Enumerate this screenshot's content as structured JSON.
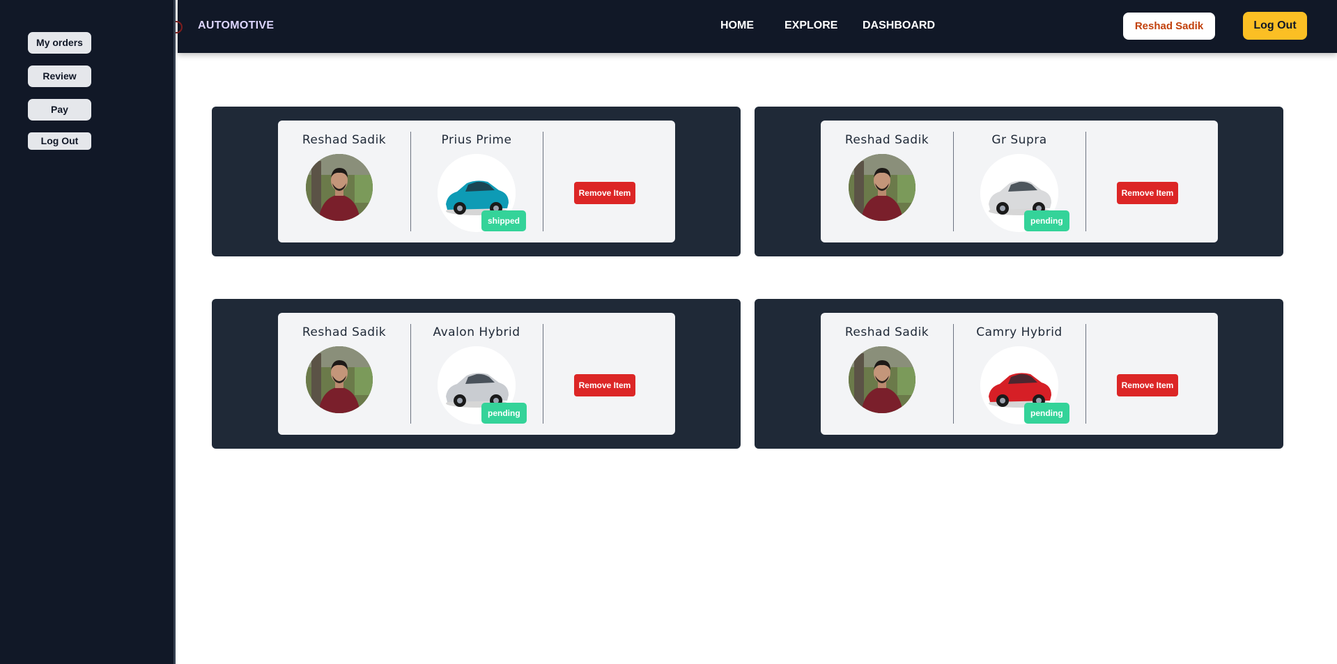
{
  "sidebar": {
    "items": [
      {
        "label": "My orders"
      },
      {
        "label": "Review"
      },
      {
        "label": "Pay"
      },
      {
        "label": "Log Out"
      }
    ]
  },
  "header": {
    "brand": "AUTOMOTIVE",
    "nav": [
      {
        "label": "HOME"
      },
      {
        "label": "EXPLORE"
      },
      {
        "label": "DASHBOARD"
      }
    ],
    "user_name": "Reshad Sadik",
    "logout_label": "Log Out"
  },
  "orders": [
    {
      "user": "Reshad Sadik",
      "product": "Prius Prime",
      "status": "shipped",
      "remove_label": "Remove Item",
      "car_color": "#0e9bb5"
    },
    {
      "user": "Reshad Sadik",
      "product": "Gr Supra",
      "status": "pending",
      "remove_label": "Remove Item",
      "car_color": "#d9dadc"
    },
    {
      "user": "Reshad Sadik",
      "product": "Avalon Hybrid",
      "status": "pending",
      "remove_label": "Remove Item",
      "car_color": "#c9ccd1"
    },
    {
      "user": "Reshad Sadik",
      "product": "Camry Hybrid",
      "status": "pending",
      "remove_label": "Remove Item",
      "car_color": "#d61f26"
    }
  ]
}
